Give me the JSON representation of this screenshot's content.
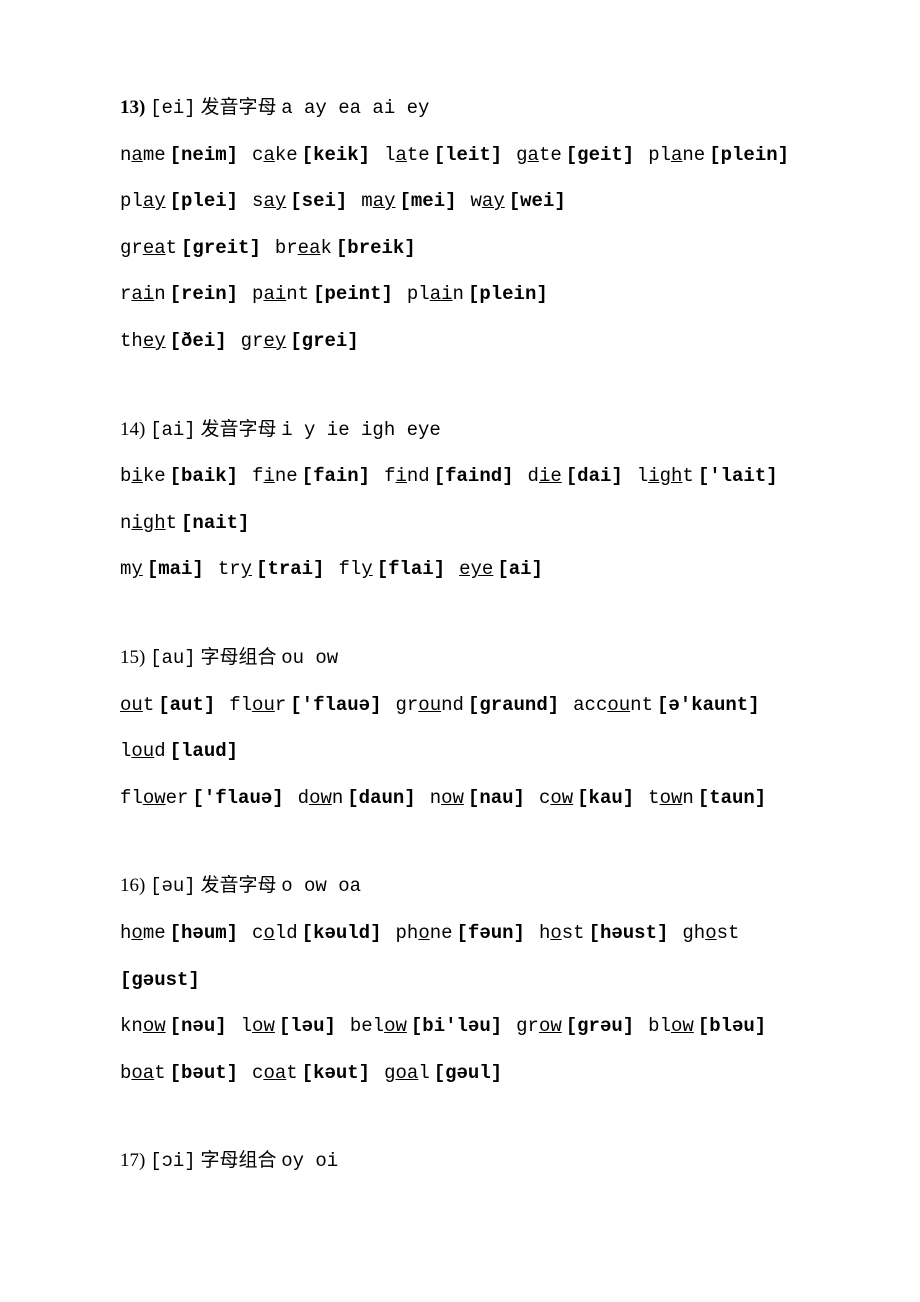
{
  "sections": [
    {
      "num": "13)",
      "num_bold": true,
      "ipa": "[ei]",
      "title_cjk": "发音字母",
      "title_letters": "a ay ea ai ey",
      "lines": [
        [
          {
            "pre": "n",
            "u": "a",
            "post": "me",
            "pr": "[neim]"
          },
          {
            "pre": "c",
            "u": "a",
            "post": "ke",
            "pr": "[keik]"
          },
          {
            "pre": "l",
            "u": "a",
            "post": "te",
            "pr": "[leit]"
          },
          {
            "pre": "g",
            "u": "a",
            "post": "te",
            "pr": "[geit]"
          },
          {
            "pre": "pl",
            "u": "a",
            "post": "ne",
            "pr": "[plein]"
          }
        ],
        [
          {
            "pre": "pl",
            "u": "ay",
            "post": "",
            "pr": "[plei]"
          },
          {
            "pre": "s",
            "u": "ay",
            "post": "",
            "pr": "[sei]"
          },
          {
            "pre": "m",
            "u": "ay",
            "post": "",
            "pr": "[mei]"
          },
          {
            "pre": "w",
            "u": "ay",
            "post": "",
            "pr": "[wei]"
          }
        ],
        [
          {
            "pre": "gr",
            "u": "ea",
            "post": "t",
            "pr": "[greit]"
          },
          {
            "pre": "br",
            "u": "ea",
            "post": "k",
            "pr": "[breik]"
          }
        ],
        [
          {
            "pre": "r",
            "u": "ai",
            "post": "n",
            "pr": "[rein]"
          },
          {
            "pre": "p",
            "u": "ai",
            "post": "nt",
            "pr": "[peint]"
          },
          {
            "pre": "pl",
            "u": "ai",
            "post": "n",
            "pr": "[plein]"
          }
        ],
        [
          {
            "pre": "th",
            "u": "ey",
            "post": "",
            "pr": "[ðei]"
          },
          {
            "pre": "gr",
            "u": "ey",
            "post": "",
            "pr": "[grei]"
          }
        ]
      ]
    },
    {
      "num": "14)",
      "num_bold": false,
      "ipa": "[ai]",
      "title_cjk": "发音字母",
      "title_letters": "i y ie igh eye",
      "lines": [
        [
          {
            "pre": "b",
            "u": "i",
            "post": "ke",
            "pr": "[baik]"
          },
          {
            "pre": "f",
            "u": "i",
            "post": "ne",
            "pr": "[fain]"
          },
          {
            "pre": "f",
            "u": "i",
            "post": "nd",
            "pr": "[faind]"
          },
          {
            "pre": "d",
            "u": "ie",
            "post": "",
            "pr": "[dai]"
          },
          {
            "pre": "l",
            "u": "igh",
            "post": "t",
            "pr": "['lait]"
          }
        ],
        [
          {
            "pre": "n",
            "u": "igh",
            "post": "t",
            "pr": "[nait]"
          }
        ],
        [
          {
            "pre": "m",
            "u": "y",
            "post": "",
            "pr": "[mai]"
          },
          {
            "pre": "tr",
            "u": "y",
            "post": "",
            "pr": "[trai]"
          },
          {
            "pre": "fl",
            "u": "y",
            "post": "",
            "pr": "[flai]"
          },
          {
            "pre": "",
            "u": "eye",
            "post": "",
            "pr": "[ai]"
          }
        ]
      ]
    },
    {
      "num": "15)",
      "num_bold": false,
      "ipa": "[au]",
      "title_cjk": "字母组合",
      "title_letters": "ou ow",
      "lines": [
        [
          {
            "pre": "",
            "u": "ou",
            "post": "t",
            "pr": "[aut]"
          },
          {
            "pre": "fl",
            "u": "ou",
            "post": "r",
            "pr": "['flauə]"
          },
          {
            "pre": "gr",
            "u": "ou",
            "post": "nd",
            "pr": "[graund]"
          },
          {
            "pre": "acc",
            "u": "ou",
            "post": "nt",
            "pr": "[ə'kaunt]"
          }
        ],
        [
          {
            "pre": "l",
            "u": "ou",
            "post": "d",
            "pr": "[laud]"
          }
        ],
        [
          {
            "pre": "fl",
            "u": "ow",
            "post": "er",
            "pr": "['flauə]"
          },
          {
            "pre": "d",
            "u": "ow",
            "post": "n",
            "pr": "[daun]"
          },
          {
            "pre": "n",
            "u": "ow",
            "post": "",
            "pr": "[nau]"
          },
          {
            "pre": "c",
            "u": "ow",
            "post": "",
            "pr": "[kau]"
          },
          {
            "pre": "t",
            "u": "ow",
            "post": "n",
            "pr": "[taun]"
          }
        ]
      ]
    },
    {
      "num": "16)",
      "num_bold": false,
      "ipa": "[əu]",
      "title_cjk": "发音字母",
      "title_letters": "o ow oa",
      "lines": [
        [
          {
            "pre": "h",
            "u": "o",
            "post": "me",
            "pr": "[həum]"
          },
          {
            "pre": "c",
            "u": "o",
            "post": "ld",
            "pr": "[kəuld]"
          },
          {
            "pre": "ph",
            "u": "o",
            "post": "ne",
            "pr": "[fəun]"
          },
          {
            "pre": "h",
            "u": "o",
            "post": "st",
            "pr": "[həust]"
          },
          {
            "pre": "gh",
            "u": "o",
            "post": "st",
            "pr": ""
          }
        ],
        [
          {
            "pre": "",
            "u": "",
            "post": "",
            "pr": "[gəust]"
          }
        ],
        [
          {
            "pre": "kn",
            "u": "ow",
            "post": "",
            "pr": "[nəu]"
          },
          {
            "pre": "l",
            "u": "ow",
            "post": "",
            "pr": "[ləu]"
          },
          {
            "pre": "bel",
            "u": "ow",
            "post": "",
            "pr": "[bi'ləu]"
          },
          {
            "pre": "gr",
            "u": "ow",
            "post": "",
            "pr": "[grəu]"
          },
          {
            "pre": "bl",
            "u": "ow",
            "post": "",
            "pr": "[bləu]"
          }
        ],
        [
          {
            "pre": "b",
            "u": "oa",
            "post": "t",
            "pr": "[bəut]"
          },
          {
            "pre": "c",
            "u": "oa",
            "post": "t",
            "pr": "[kəut]"
          },
          {
            "pre": "g",
            "u": "oa",
            "post": "l",
            "pr": "[gəul]"
          }
        ]
      ]
    },
    {
      "num": "17)",
      "num_bold": false,
      "ipa": "[ɔi]",
      "title_cjk": "字母组合",
      "title_letters": "oy oi",
      "lines": []
    }
  ]
}
